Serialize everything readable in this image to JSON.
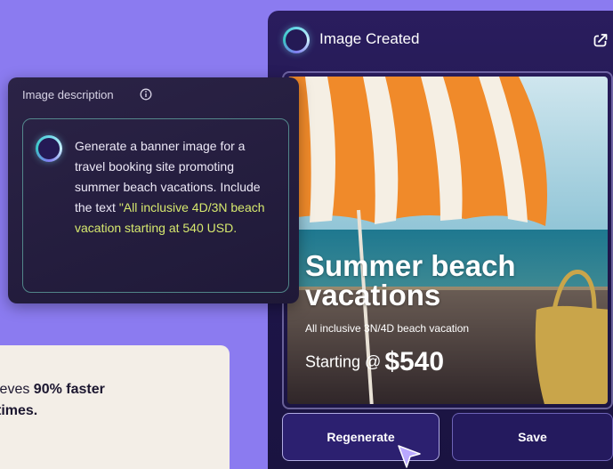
{
  "quote_card": {
    "text_start": "ieves ",
    "text_bold_1": "90% faster",
    "text_bold_2": " times."
  },
  "image_panel": {
    "title": "Image Created",
    "icons": {
      "status": "spinner-ring-icon",
      "share": "share-icon"
    },
    "generated_image": {
      "heading": "Summer beach vacations",
      "subheading": "All inclusive 3N/4D beach vacation",
      "price_prefix": "Starting @",
      "price": "$540"
    },
    "buttons": {
      "regenerate": "Regenerate",
      "save": "Save"
    }
  },
  "description_card": {
    "label": "Image description",
    "text_plain": "Generate a banner image for a travel booking site promoting summer beach vacations. Include the text ",
    "text_quoted": "\"All inclusive 4D/3N beach vacation starting at 540 USD."
  },
  "colors": {
    "background": "#8b7bf0",
    "panel": "#241a55",
    "accent_cyan": "#6ad8e8",
    "quote_highlight": "#d6e86e",
    "card_bg": "#f3eee7"
  }
}
